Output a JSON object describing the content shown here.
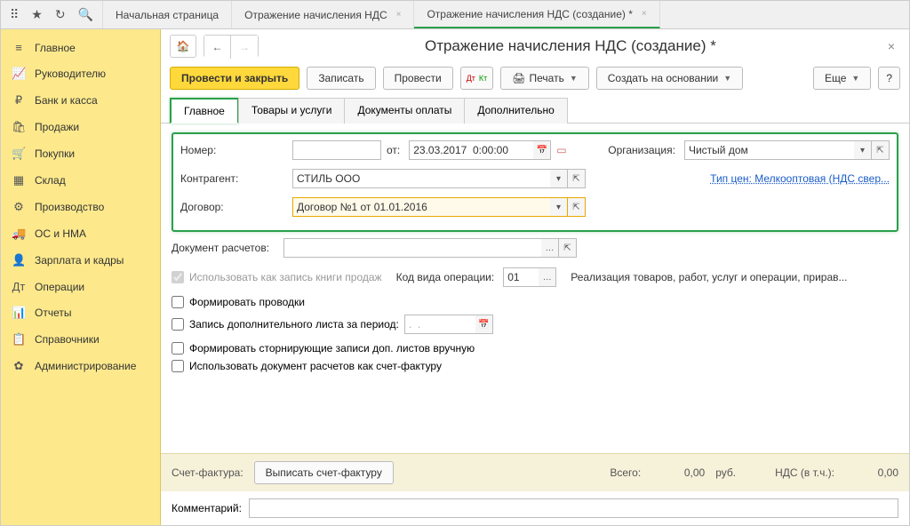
{
  "tabs": {
    "home": "Начальная страница",
    "t1": "Отражение начисления НДС",
    "t2": "Отражение начисления НДС (создание) *"
  },
  "sidebar": [
    {
      "icon": "≡",
      "label": "Главное"
    },
    {
      "icon": "📈",
      "label": "Руководителю"
    },
    {
      "icon": "₽",
      "label": "Банк и касса"
    },
    {
      "icon": "🛍",
      "label": "Продажи"
    },
    {
      "icon": "🛒",
      "label": "Покупки"
    },
    {
      "icon": "▦",
      "label": "Склад"
    },
    {
      "icon": "⚙",
      "label": "Производство"
    },
    {
      "icon": "🚚",
      "label": "ОС и НМА"
    },
    {
      "icon": "👤",
      "label": "Зарплата и кадры"
    },
    {
      "icon": "Дт",
      "label": "Операции"
    },
    {
      "icon": "📊",
      "label": "Отчеты"
    },
    {
      "icon": "📋",
      "label": "Справочники"
    },
    {
      "icon": "✿",
      "label": "Администрирование"
    }
  ],
  "title": "Отражение начисления НДС (создание) *",
  "toolbar": {
    "primary": "Провести и закрыть",
    "write": "Записать",
    "post": "Провести",
    "print": "Печать",
    "create_based": "Создать на основании",
    "more": "Еще"
  },
  "doc_tabs": [
    "Главное",
    "Товары и услуги",
    "Документы оплаты",
    "Дополнительно"
  ],
  "labels": {
    "number": "Номер:",
    "from": "от:",
    "org": "Организация:",
    "contractor": "Контрагент:",
    "contract": "Договор:",
    "settlement_doc": "Документ расчетов:",
    "op_code": "Код вида операции:",
    "invoice": "Счет-фактура:",
    "total": "Всего:",
    "currency": "руб.",
    "vat": "НДС (в т.ч.):",
    "comment": "Комментарий:"
  },
  "values": {
    "number": "",
    "date": "23.03.2017  0:00:00",
    "org": "Чистый дом",
    "contractor": "СТИЛЬ ООО",
    "contract": "Договор №1 от 01.01.2016",
    "price_type_link": "Тип цен: Мелкооптовая (НДС свер...",
    "op_code": "01",
    "op_desc": "Реализация товаров, работ, услуг и операции, прирав...",
    "total": "0,00",
    "vat": "0,00",
    "period": ".  ."
  },
  "checks": {
    "sales_book": "Использовать как запись книги продаж",
    "form_entries": "Формировать проводки",
    "add_sheet": "Запись дополнительного листа за период:",
    "storno": "Формировать сторнирующие записи доп. листов вручную",
    "as_invoice": "Использовать документ расчетов как счет-фактуру"
  },
  "buttons": {
    "write_invoice": "Выписать счет-фактуру"
  }
}
